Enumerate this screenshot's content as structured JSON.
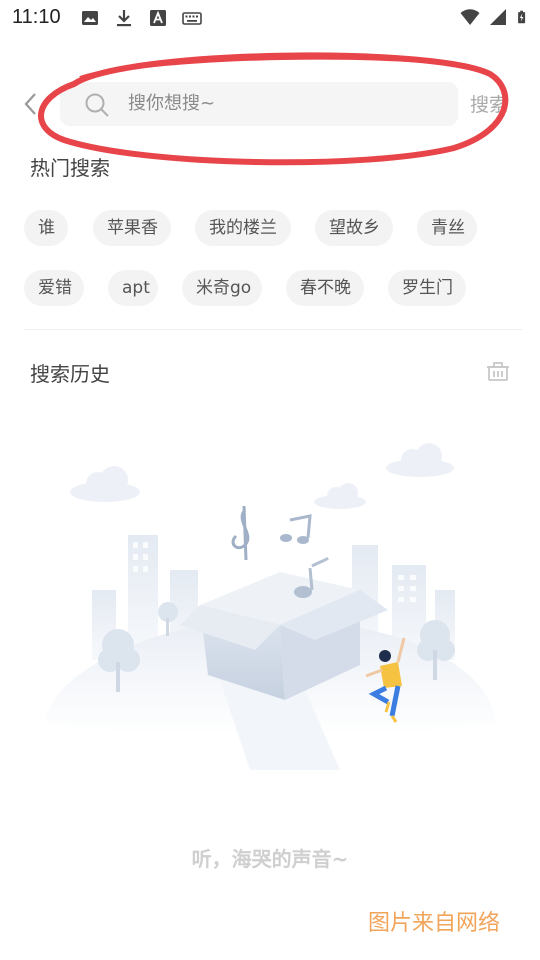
{
  "status_bar": {
    "time": "11:10",
    "left_icons": [
      "image-icon",
      "download-icon",
      "font-a-icon",
      "keyboard-icon"
    ],
    "right_icons": [
      "wifi-icon",
      "signal-icon",
      "battery-charging-icon"
    ]
  },
  "search": {
    "placeholder": "搜你想搜~",
    "submit_label": "搜索"
  },
  "hot_search": {
    "title": "热门搜索",
    "tags": [
      "谁",
      "苹果香",
      "我的楼兰",
      "望故乡",
      "青丝",
      "爱错",
      "apt",
      "米奇go",
      "春不晚",
      "罗生门"
    ]
  },
  "history": {
    "title": "搜索历史",
    "empty_text": "听，海哭的声音~"
  },
  "watermark": "图片来自网络",
  "colors": {
    "annotation_ring": "#e8454a",
    "watermark": "#f2a45a",
    "tag_bg": "#f3f3f3",
    "search_bg": "#f5f5f5"
  }
}
